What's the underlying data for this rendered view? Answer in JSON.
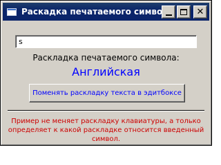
{
  "window": {
    "title": "Раскадка печатаемого символа",
    "minimize_label": "",
    "maximize_label": "",
    "close_label": "✕"
  },
  "edit": {
    "value": "s"
  },
  "label": "Раскладка печатаемого символа:",
  "layout_value": "Английская",
  "button_label": "Поменять раскладку текста в эдитбоксе",
  "note": "Пример не меняет раскладку клавиатуры, а только определяет к какой раскладке относится введенный символ.",
  "colors": {
    "titlebar": "#0a246a",
    "window_bg": "#d4d0c8",
    "value_text": "#0000ff",
    "button_text": "#0000ff",
    "note_text": "#cc0000"
  }
}
